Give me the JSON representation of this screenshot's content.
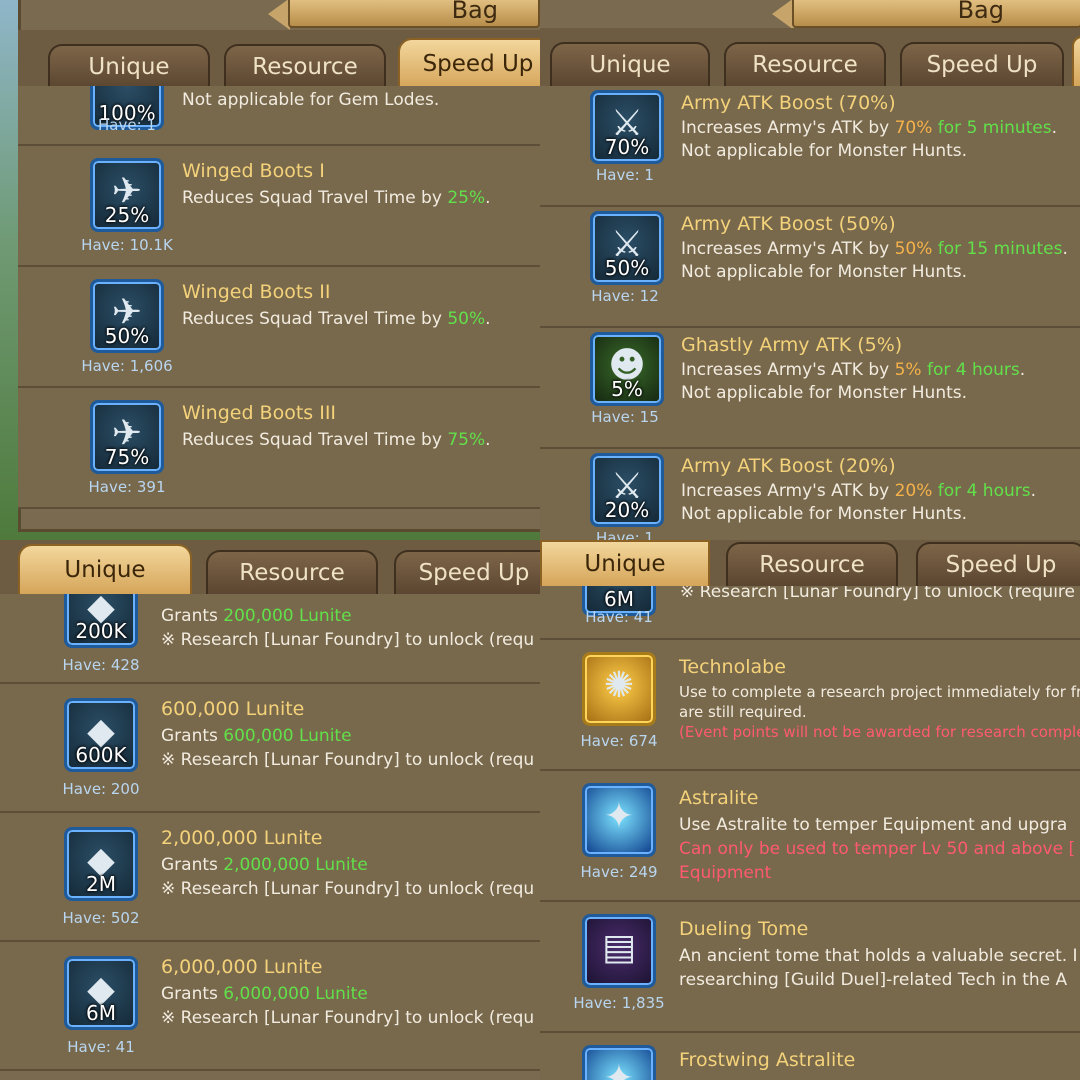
{
  "bag_title": "Bag",
  "tabs": {
    "unique": "Unique",
    "resource": "Resource",
    "speed_up": "Speed Up"
  },
  "q1": {
    "partial_have": "Have: 1",
    "partial_pct": "100%",
    "partial_desc": "Not applicable for Gem Lodes.",
    "items": [
      {
        "name": "Winged Boots I",
        "desc_pre": "Reduces Squad Travel Time by ",
        "desc_val": "25%",
        "desc_post": ".",
        "pct": "25%",
        "have": "Have: 10.1K"
      },
      {
        "name": "Winged Boots II",
        "desc_pre": "Reduces Squad Travel Time by ",
        "desc_val": "50%",
        "desc_post": ".",
        "pct": "50%",
        "have": "Have: 1,606"
      },
      {
        "name": "Winged Boots III",
        "desc_pre": "Reduces Squad Travel Time by ",
        "desc_val": "75%",
        "desc_post": ".",
        "pct": "75%",
        "have": "Have: 391"
      }
    ]
  },
  "q2": {
    "items": [
      {
        "name": "Army ATK Boost (70%)",
        "pre": "Increases Army's ATK by ",
        "val": "70%",
        "dur": " for 5 minutes",
        "post": ".",
        "note": "Not applicable for Monster Hunts.",
        "pct": "70%",
        "have": "Have: 1"
      },
      {
        "name": "Army ATK Boost (50%)",
        "pre": "Increases Army's ATK by ",
        "val": "50%",
        "dur": " for 15 minutes",
        "post": ".",
        "note": "Not applicable for Monster Hunts.",
        "pct": "50%",
        "have": "Have: 12"
      },
      {
        "name": "Ghastly Army ATK (5%)",
        "pre": "Increases Army's ATK by ",
        "val": "5%",
        "dur": " for 4 hours",
        "post": ".",
        "note": "Not applicable for Monster Hunts.",
        "pct": "5%",
        "have": "Have: 15"
      },
      {
        "name": "Army ATK Boost (20%)",
        "pre": "Increases Army's ATK by ",
        "val": "20%",
        "dur": " for 4 hours",
        "post": ".",
        "note": "Not applicable for Monster Hunts.",
        "pct": "20%",
        "have": "Have: 1"
      }
    ]
  },
  "q3": {
    "items": [
      {
        "name": "200,000 Lunite",
        "grant_pre": "Grants ",
        "grant_val": "200,000 Lunite",
        "req": "※ Research [Lunar Foundry] to unlock (requ",
        "pct": "200K",
        "have": "Have: 428"
      },
      {
        "name": "600,000 Lunite",
        "grant_pre": "Grants ",
        "grant_val": "600,000 Lunite",
        "req": "※ Research [Lunar Foundry] to unlock (requ",
        "pct": "600K",
        "have": "Have: 200"
      },
      {
        "name": "2,000,000 Lunite",
        "grant_pre": "Grants ",
        "grant_val": "2,000,000 Lunite",
        "req": "※ Research [Lunar Foundry] to unlock (requ",
        "pct": "2M",
        "have": "Have: 502"
      },
      {
        "name": "6,000,000 Lunite",
        "grant_pre": "Grants ",
        "grant_val": "6,000,000 Lunite",
        "req": "※ Research [Lunar Foundry] to unlock (requ",
        "pct": "6M",
        "have": "Have: 41"
      }
    ]
  },
  "q4": {
    "partial_have": "Have: 41",
    "partial_pct": "6M",
    "partial_desc": "※ Research [Lunar Foundry] to unlock (require",
    "items": [
      {
        "name": "Technolabe",
        "l1": "Use to complete a research project immediately for free",
        "l2": "are still required.",
        "l3": "(Event points will not be awarded for research complete",
        "have": "Have: 674"
      },
      {
        "name": "Astralite",
        "l1": "Use Astralite to temper Equipment and upgra",
        "l2": "Can only be used to temper Lv 50 and above [",
        "l3": "Equipment",
        "have": "Have: 249"
      },
      {
        "name": "Dueling Tome",
        "l1": "An ancient tome that holds a valuable secret. I",
        "l2": "researching [Guild Duel]-related Tech in the A",
        "have": "Have: 1,835"
      },
      {
        "name": "Frostwing Astralite"
      }
    ]
  }
}
